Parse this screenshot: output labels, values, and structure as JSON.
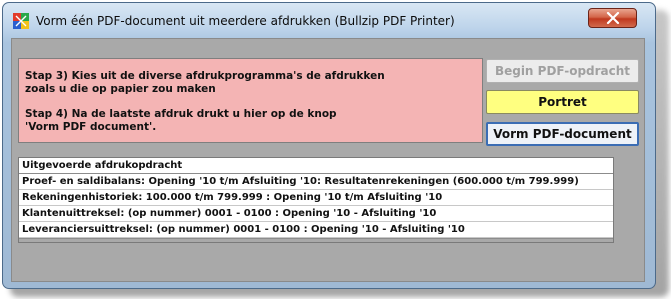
{
  "window": {
    "title": "Vorm één PDF-document uit meerdere afdrukken (Bullzip PDF Printer)",
    "close_icon": "close-icon"
  },
  "instructions": {
    "step3": "Stap 3)  Kies uit de diverse afdrukprogramma's de afdrukken\nzoals u die op papier zou maken",
    "step4": "Stap 4)  Na de laatste afdruk drukt u hier op de knop\n'Vorm PDF document'."
  },
  "buttons": {
    "begin": "Begin PDF-opdracht",
    "portrait": "Portret",
    "make_pdf": "Vorm PDF-document"
  },
  "jobs": {
    "header": "Uitgevoerde afdrukopdracht",
    "rows": [
      "Proef- en saldibalans: Opening '10 t/m Afsluiting '10: Resultatenrekeningen   (600.000 t/m 799.999)",
      "Rekeningenhistoriek: 100.000 t/m 799.999 : Opening '10 t/m Afsluiting '10",
      "Klantenuittreksel:  (op nummer) 0001 - 0100 : Opening '10 - Afsluiting '10",
      "Leveranciersuittreksel:  (op nummer) 0001 - 0100 : Opening '10 - Afsluiting '10"
    ]
  },
  "colors": {
    "instructions_bg": "#f4b4b4",
    "portrait_bg": "#ffff80",
    "client_bg": "#a9a9a9"
  }
}
